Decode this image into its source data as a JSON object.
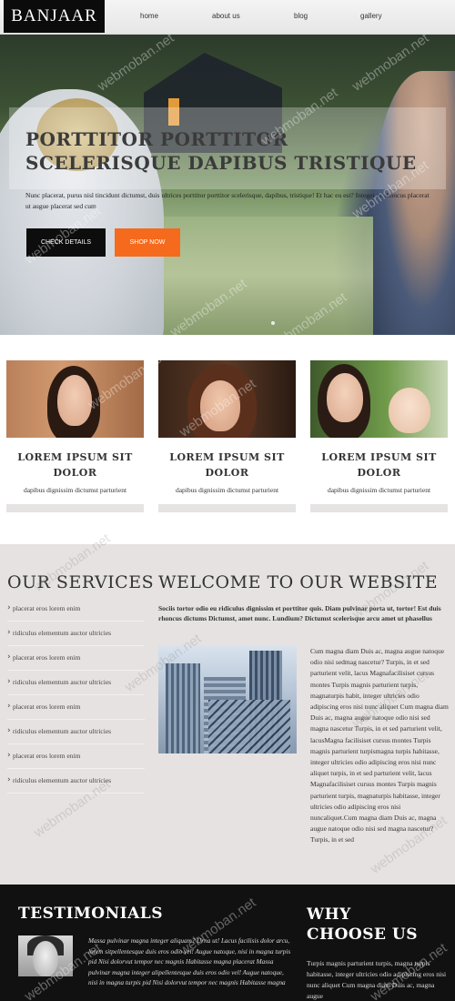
{
  "header": {
    "logo": "BANJAAR",
    "nav": [
      {
        "label": "home"
      },
      {
        "label": "about us"
      },
      {
        "label": "blog"
      },
      {
        "label": "gallery"
      }
    ]
  },
  "hero": {
    "title": "PORTTITOR PORTTITOR SCELERISQUE DAPIBUS TRISTIQUE",
    "text": "Nunc placerat, purus nisl tincidunt dictumst, duis ultrices porttitor porttitor scelerisque, dapibus, tristique! Et hac eu est? Integer ac rhoncus placerat ut augue placerat sed cum",
    "btn_details": "CHECK DETAILS",
    "btn_shop": "SHOP NOW"
  },
  "cards": [
    {
      "title": "LOREM IPSUM SIT DOLOR",
      "desc": "dapibus dignissim dictumst parturient"
    },
    {
      "title": "LOREM IPSUM SIT DOLOR",
      "desc": "dapibus dignissim dictumst parturient"
    },
    {
      "title": "LOREM IPSUM SIT DOLOR",
      "desc": "dapibus dignissim dictumst parturient"
    }
  ],
  "services": {
    "title": "OUR SERVICES",
    "items": [
      "placerat eros lorem enim",
      "ridiculus elementum auctor ultricies",
      "placerat eros lorem enim",
      "ridiculus elementum auctor ultricies",
      "placerat eros lorem enim",
      "ridiculus elementum auctor ultricies",
      "placerat eros lorem enim",
      "ridiculus elementum auctor ultricies"
    ]
  },
  "welcome": {
    "title": "WELCOME TO OUR WEBSITE",
    "lead": "Sociis tortor odio eu ridiculus dignissim et porttitor quis. Diam pulvinar porta ut, tortor! Est duis rhoncus dictums Dictumst, amet nunc. Lundium? Dictumst scelerisque arcu amet ut phasellus",
    "body": "Cum magna diam Duis ac, magna augue natoque odio nisi sedmag nascetur? Turpis, in et sed parturient velit, lacus Magnafacilisiset cursus montes Turpis magnis parturient turpis, magnaturpis habit, integer ultricies odio adipiscing eros nisi nunc aliquet Cum magna diam Duis ac, magna augue natoque odio nisi sed magna nascetur Turpis, in et sed parturient velit, lacusMagna facilisiset cursus montes Turpis magnis parturient turpismagna turpis habitasse, integer ultricies odio adipiscing eros nisi nunc aliquet turpis, in et sed parturient velit, lacus Magnafacilisiset cursus montes Turpis magnis parturient turpis, magnaturpis habitasse, integer ultricies odio adipiscing eros nisi nuncaliquet.Cum magna diam Duis ac, magna augue natoque odio nisi sed magna nascetur? Turpis, in et sed"
  },
  "testimonials": {
    "title": "TESTIMONIALS",
    "text": "Massa pulvinar magna integer aliquam? Urna ut! Lacus facilisis dolor arcu, lorem sitpellentesque duis eros odio vel! Augue natoque, nisi in magna turpis pid Nisi dolorvut tempor nec magnis Habitasse magna placerat Massa pulvinar magna integer alipellentesque duis eros odio vel! Augue natoque, nisi in magna turpis pid Nisi dolorvut tempor nec magnis Habitasse magna"
  },
  "why": {
    "title": "WHY CHOOSE US",
    "text": "Turpis magnis parturient turpis, magna turpis habitasse, integer ultricies odio adipiscing eros nisi nunc aliquet Cum magna diam Duis ac, magna augue"
  },
  "watermark": "webmoban.net",
  "colors": {
    "accent_orange": "#f56a1c",
    "dark": "#0d0d0d",
    "section_bg": "#e6e2e2",
    "footer_bg": "#111111"
  },
  "icons": {
    "service_bullet": "chevron-right-icon"
  }
}
